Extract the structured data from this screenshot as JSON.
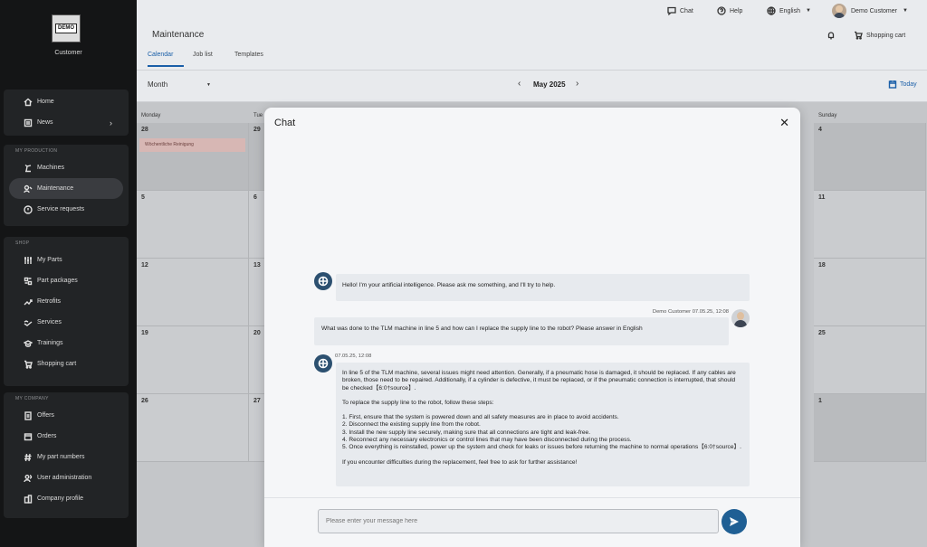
{
  "sidebar": {
    "logo_text": "DEMO",
    "role": "Customer",
    "groups": [
      {
        "header": "",
        "items": [
          {
            "label": "Home",
            "icon": "home-icon"
          },
          {
            "label": "News",
            "icon": "news-icon",
            "chevron": true
          }
        ]
      },
      {
        "header": "MY PRODUCTION",
        "items": [
          {
            "label": "Machines",
            "icon": "machine-icon"
          },
          {
            "label": "Maintenance",
            "icon": "maintenance-icon",
            "active": true
          },
          {
            "label": "Service requests",
            "icon": "service-request-icon"
          }
        ]
      },
      {
        "header": "SHOP",
        "items": [
          {
            "label": "My Parts",
            "icon": "parts-icon"
          },
          {
            "label": "Part packages",
            "icon": "package-icon"
          },
          {
            "label": "Retrofits",
            "icon": "trend-icon"
          },
          {
            "label": "Services",
            "icon": "services-icon"
          },
          {
            "label": "Trainings",
            "icon": "training-icon"
          },
          {
            "label": "Shopping cart",
            "icon": "cart-icon"
          }
        ]
      },
      {
        "header": "MY COMPANY",
        "items": [
          {
            "label": "Offers",
            "icon": "offers-icon"
          },
          {
            "label": "Orders",
            "icon": "orders-icon"
          },
          {
            "label": "My part numbers",
            "icon": "hash-icon"
          },
          {
            "label": "User administration",
            "icon": "users-icon"
          },
          {
            "label": "Company profile",
            "icon": "company-icon"
          }
        ]
      }
    ]
  },
  "header": {
    "chat": "Chat",
    "help": "Help",
    "language": "English",
    "user": "Demo Customer",
    "shopping_cart": "Shopping cart",
    "title": "Maintenance",
    "tabs": [
      "Calendar",
      "Job list",
      "Templates"
    ]
  },
  "calendar": {
    "view": "Month",
    "month_label": "May 2025",
    "today": "Today",
    "day_headers": [
      "Monday",
      "Tue",
      "Sunday"
    ],
    "rows": [
      [
        "28",
        "29",
        "4"
      ],
      [
        "5",
        "6",
        "11"
      ],
      [
        "12",
        "13",
        "18"
      ],
      [
        "19",
        "20",
        "25"
      ],
      [
        "26",
        "27",
        "1"
      ]
    ],
    "event": "Wöchentliche Reinigung"
  },
  "chat": {
    "title": "Chat",
    "messages": [
      {
        "from": "bot",
        "text": "Hello! I'm your artificial intelligence. Please ask me something, and I'll try to help."
      },
      {
        "from": "user",
        "meta": "Demo Customer 07.05.25, 12:08",
        "text": "What was done to the TLM machine in line 5 and how can I replace the supply line to the robot? Please answer in English"
      },
      {
        "from": "bot",
        "meta": "07.05.25, 12:08",
        "paragraphs": [
          "In line 5 of the TLM machine, several issues might need attention. Generally, if a pneumatic hose is damaged, it should be replaced. If any cables are broken, those need to be repaired. Additionally, if a cylinder is defective, it must be replaced, or if the pneumatic connection is interrupted, that should be checked【6:0†source】.",
          "To replace the supply line to the robot, follow these steps:",
          "1. First, ensure that the system is powered down and all safety measures are in place to avoid accidents.",
          "2. Disconnect the existing supply line from the robot.",
          "3. Install the new supply line securely, making sure that all connections are tight and leak-free.",
          "4. Reconnect any necessary electronics or control lines that may have been disconnected during the process.",
          "5. Once everything is reinstalled, power up the system and check for leaks or issues before returning the machine to normal operations【6:0†source】.",
          "If you encounter difficulties during the replacement, feel free to ask for further assistance!"
        ]
      }
    ],
    "input_placeholder": "Please enter your message here"
  }
}
